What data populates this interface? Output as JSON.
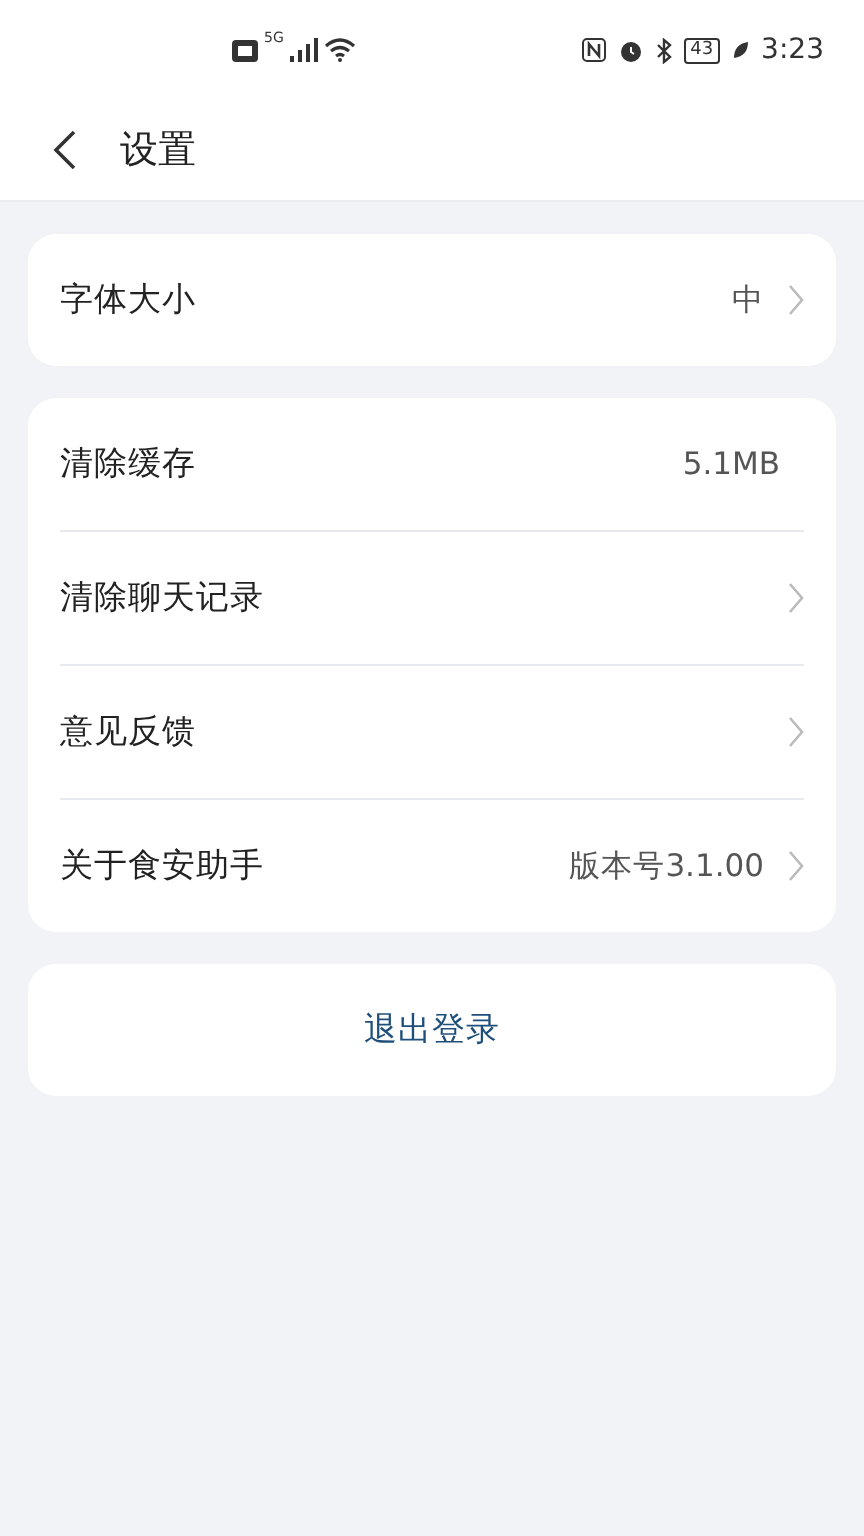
{
  "status_bar": {
    "network": "5G",
    "battery": "43",
    "time": "3:23"
  },
  "header": {
    "title": "设置"
  },
  "groups": [
    {
      "rows": [
        {
          "label": "字体大小",
          "value": "中",
          "chevron": true
        }
      ]
    },
    {
      "rows": [
        {
          "label": "清除缓存",
          "value": "5.1MB",
          "chevron": false
        },
        {
          "label": "清除聊天记录",
          "chevron": true
        },
        {
          "label": "意见反馈",
          "chevron": true
        },
        {
          "label": "关于食安助手",
          "value": "版本号3.1.00",
          "chevron": true
        }
      ]
    }
  ],
  "logout_button": "退出登录"
}
